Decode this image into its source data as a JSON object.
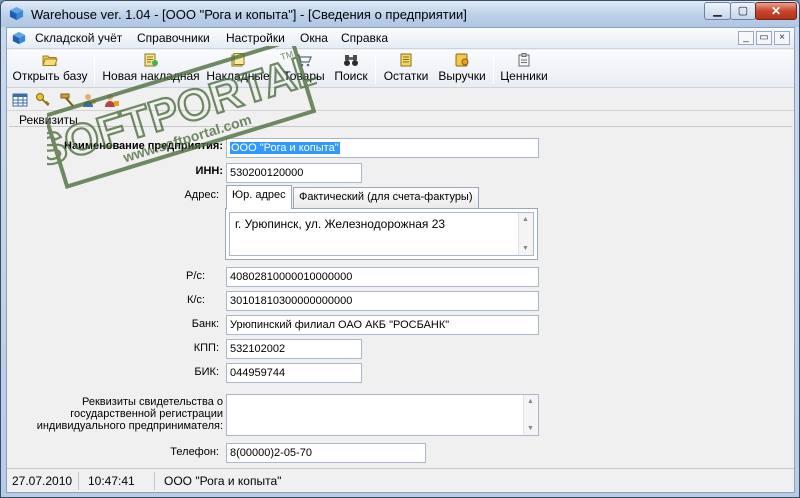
{
  "window": {
    "title": "Warehouse ver. 1.04 - [ООО \"Рога и копыта\"] - [Сведения о предприятии]",
    "controls": {
      "minimize": "▁",
      "maximize": "▢",
      "close": "✕"
    }
  },
  "menu": {
    "items": [
      "Складской учёт",
      "Справочники",
      "Настройки",
      "Окна",
      "Справка"
    ],
    "mdi": {
      "minimize": "_",
      "restore": "▭",
      "close": "×"
    }
  },
  "toolbar": {
    "buttons": [
      {
        "label": "Открыть базу",
        "icon": "folder-open-icon"
      },
      {
        "label": "Новая накладная",
        "icon": "new-invoice-icon"
      },
      {
        "label": "Накладные",
        "icon": "invoices-icon"
      },
      {
        "label": "Товары",
        "icon": "goods-icon"
      },
      {
        "label": "Поиск",
        "icon": "binoculars-icon"
      },
      {
        "label": "Остатки",
        "icon": "stock-icon"
      },
      {
        "label": "Выручки",
        "icon": "revenue-icon"
      },
      {
        "label": "Ценники",
        "icon": "price-tags-icon"
      }
    ]
  },
  "secondary_toolbar": {
    "icons": [
      "table-icon",
      "key-icon",
      "hammer-icon",
      "user-key-icon",
      "user-lock-icon"
    ]
  },
  "page": {
    "tab_label": "Реквизиты",
    "fields": {
      "company_name": {
        "label": "Наименование предприятия:",
        "value": "ООО \"Рога и копыта\""
      },
      "inn": {
        "label": "ИНН:",
        "value": "530200120000"
      },
      "address": {
        "label": "Адрес:",
        "tabs": [
          "Юр. адрес",
          "Фактический (для счета-фактуры)"
        ],
        "value": "г. Урюпинск, ул. Железнодорожная 23"
      },
      "rs": {
        "label": "Р/с:",
        "value": "40802810000010000000"
      },
      "ks": {
        "label": "К/с:",
        "value": "30101810300000000000"
      },
      "bank": {
        "label": "Банк:",
        "value": "Урюпинский филиал ОАО АКБ \"РОСБАНК\""
      },
      "kpp": {
        "label": "КПП:",
        "value": "532102002"
      },
      "bik": {
        "label": "БИК:",
        "value": "044959744"
      },
      "registration": {
        "label_lines": [
          "Реквизиты свидетельства о",
          "государственной регистрации",
          "индивидуального предпринимателя:"
        ],
        "value": ""
      },
      "phone": {
        "label": "Телефон:",
        "value": "8(00000)2-05-70"
      }
    }
  },
  "statusbar": {
    "date": "27.07.2010",
    "time": "10:47:41",
    "company": "ООО \"Рога и копыта\""
  },
  "watermark": {
    "brand": "SOFTPORTAL",
    "trademark": "TM",
    "url": "www.softportal.com"
  },
  "colors": {
    "selection": "#3399ff",
    "watermark": "#4a6b3a"
  }
}
